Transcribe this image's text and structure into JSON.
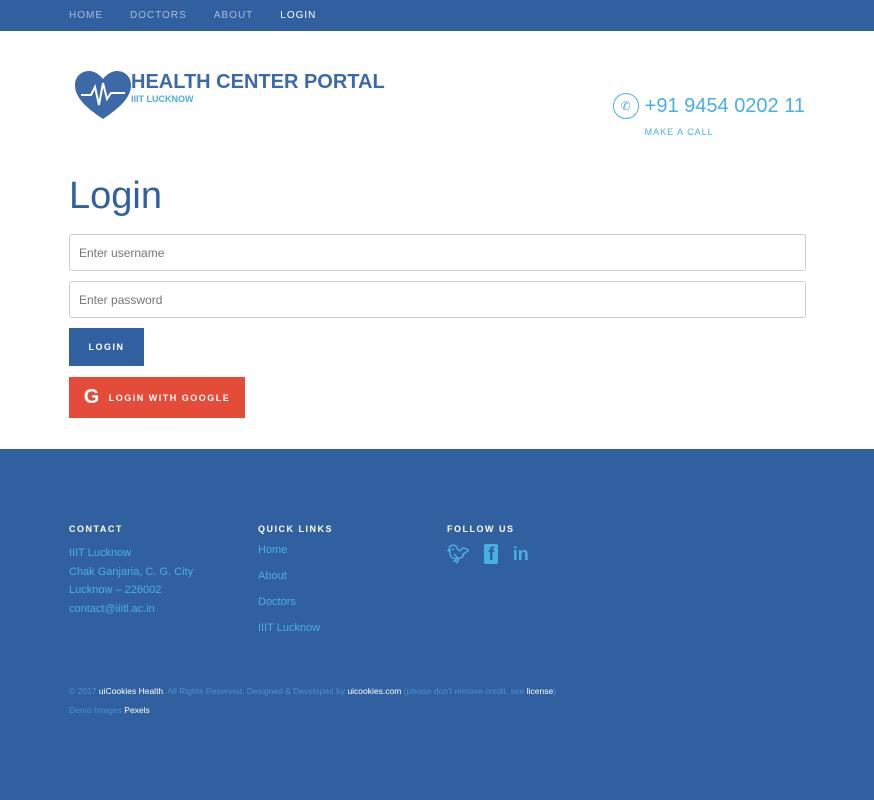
{
  "nav": {
    "items": [
      {
        "label": "HOME"
      },
      {
        "label": "DOCTORS"
      },
      {
        "label": "ABOUT"
      },
      {
        "label": "LOGIN"
      }
    ]
  },
  "header": {
    "title": "HEALTH CENTER PORTAL",
    "subtitle": "IIIT LUCKNOW",
    "phone": "+91 9454 0202 11",
    "call_label": "MAKE A CALL"
  },
  "login": {
    "title": "Login",
    "username_placeholder": "Enter username",
    "password_placeholder": "Enter password",
    "login_label": "LOGIN",
    "google_label": "LOGIN WITH GOOGLE"
  },
  "footer": {
    "contact": {
      "heading": "CONTACT",
      "lines": [
        "IIIT Lucknow",
        "Chak Ganjaria, C. G. City",
        "Lucknow – 226002",
        "contact@iiitl.ac.in"
      ]
    },
    "quick": {
      "heading": "QUICK LINKS",
      "links": [
        "Home",
        "About",
        "Doctors",
        "IIIT Lucknow"
      ]
    },
    "follow": {
      "heading": "FOLLOW US",
      "icons": [
        "twitter-icon",
        "facebook-icon",
        "linkedin-icon"
      ]
    },
    "copy": {
      "a": "© 2017 ",
      "b": "uiCookies Health",
      "c": ". All Rights Reserved. Designed & Developed by ",
      "d": "uicookies.com",
      "e": " (please don't remove credit, see ",
      "f": "license",
      "g": ")",
      "h": "Demo Images ",
      "i": "Pexels"
    }
  }
}
